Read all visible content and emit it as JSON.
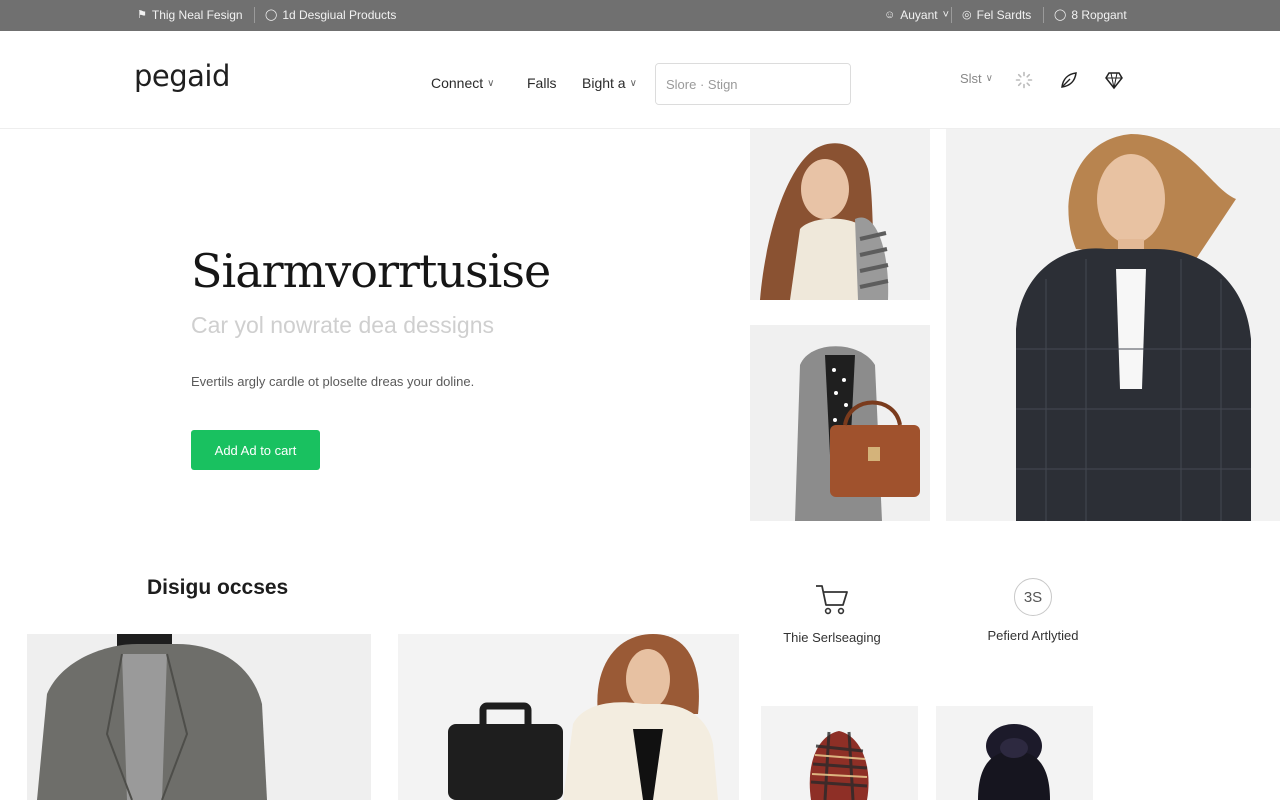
{
  "topbar": {
    "left_items": [
      {
        "icon": "flag-icon",
        "label": "Thig Neal Fesign"
      },
      {
        "icon": "circle-icon",
        "label": "1d Desgiual Products"
      }
    ],
    "right_items": [
      {
        "icon": "user-icon",
        "label": "Auyant"
      },
      {
        "icon": "globe-icon",
        "label": "Fel Sardts"
      },
      {
        "icon": "support-icon",
        "label": "8 Ropgant"
      }
    ]
  },
  "header": {
    "logo": "pegaid",
    "nav": [
      {
        "label": "Connect",
        "dropdown": true
      },
      {
        "label": "Falls",
        "dropdown": false
      },
      {
        "label": "Bight a",
        "dropdown": true
      }
    ],
    "search": {
      "placeholder": "Slore · Stign"
    },
    "sort": {
      "label": "Slst"
    },
    "icons": [
      "loader-icon",
      "leaf-icon",
      "diamond-icon"
    ]
  },
  "hero": {
    "title": "Siarmvorrtusise",
    "subtitle": "Car yol nowrate dea dessigns",
    "description": "Evertils argly cardle ot ploselte dreas your doline.",
    "cta_label": "Add Ad to cart"
  },
  "section": {
    "title": "Disigu occses",
    "features": [
      {
        "icon": "cart-icon",
        "label": "Thie Serlseaging"
      },
      {
        "badge": "3S",
        "label": "Pefierd Artlytied"
      }
    ]
  },
  "colors": {
    "accent": "#19c160",
    "topbar_bg": "#707070",
    "text_primary": "#161616",
    "subtitle": "#cfcfcf"
  }
}
